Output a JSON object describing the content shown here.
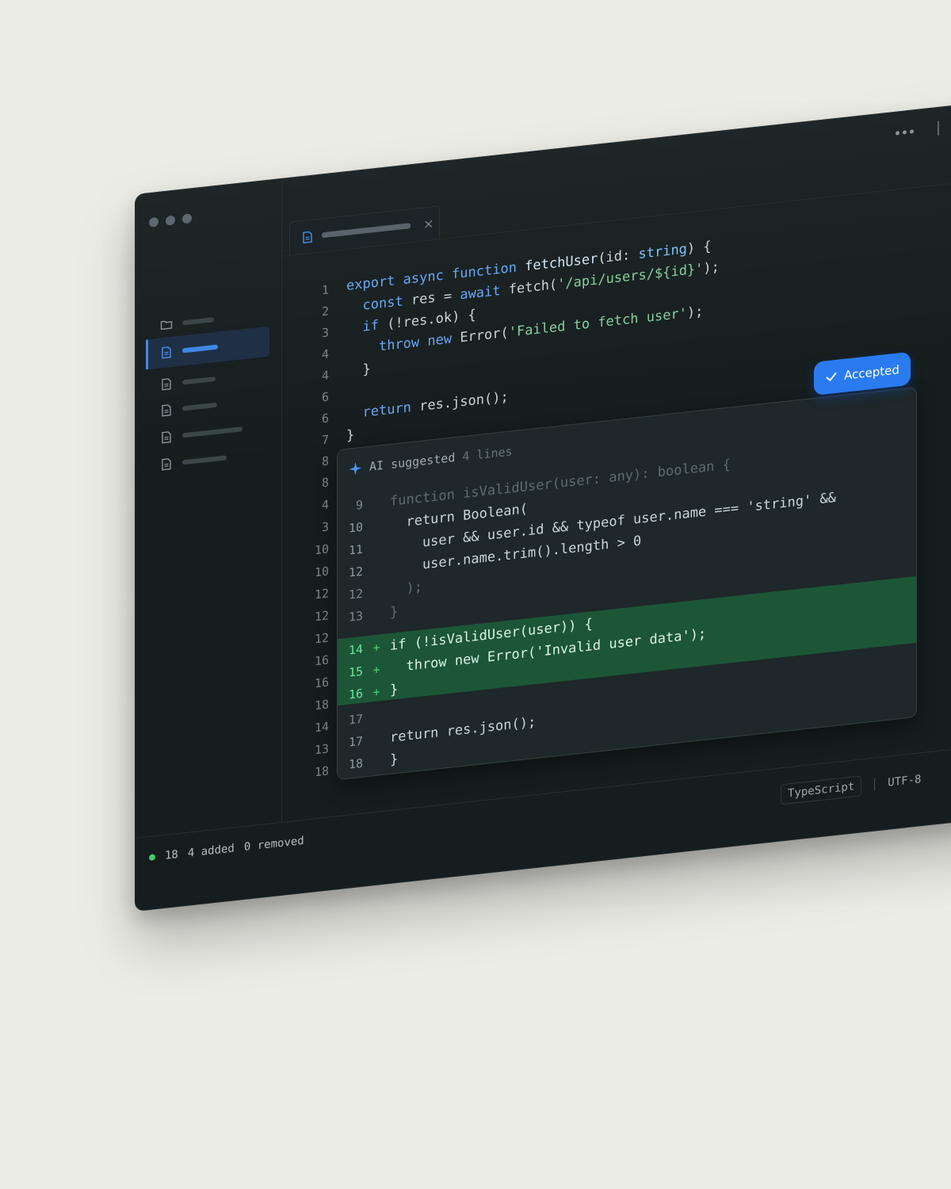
{
  "editor": {
    "code_lines": [
      {
        "num": "1",
        "html": "<span class=\"kw\">export async function</span> <span class=\"fn\">fetchUser</span>(id: <span class=\"ty\">string</span>) {"
      },
      {
        "num": "2",
        "html": "  <span class=\"kw\">const</span> res = <span class=\"kw\">await</span> fetch(<span class=\"str\">'/api/users/${id}'</span>);"
      },
      {
        "num": "3",
        "html": "  <span class=\"kw\">if</span> (!res.ok) {"
      },
      {
        "num": "4",
        "html": "    <span class=\"kw\">throw new</span> Error(<span class=\"str\">'Failed to fetch user'</span>);"
      },
      {
        "num": "4",
        "html": "  }"
      },
      {
        "num": "6",
        "html": ""
      },
      {
        "num": "6",
        "html": "  <span class=\"kw\">return</span> res.json();"
      },
      {
        "num": "7",
        "html": "}"
      },
      {
        "num": "8",
        "html": ""
      }
    ],
    "panel_gutter": [
      "8",
      "4",
      "3",
      "10",
      "10",
      "12",
      "12",
      "12",
      "16",
      "16",
      "18",
      "14",
      "13",
      "18"
    ]
  },
  "ai_panel": {
    "title": "AI suggested",
    "count_label": "4 lines",
    "lines": [
      {
        "num": "9",
        "plus": "",
        "text": "function isValidUser(user: any): boolean {",
        "dim": true
      },
      {
        "num": "10",
        "plus": "",
        "text": "  return Boolean(",
        "dim": false
      },
      {
        "num": "11",
        "plus": "",
        "text": "    user && user.id && typeof user.name === 'string' &&",
        "dim": false
      },
      {
        "num": "12",
        "plus": "",
        "text": "    user.name.trim().length > 0",
        "dim": false
      },
      {
        "num": "12",
        "plus": "",
        "text": "  );",
        "dim": true
      },
      {
        "num": "13",
        "plus": "",
        "text": "}",
        "dim": true
      },
      {
        "num": "14",
        "plus": "+",
        "text": "if (!isValidUser(user)) {",
        "dim": false,
        "added": true
      },
      {
        "num": "15",
        "plus": "+",
        "text": "  throw new Error('Invalid user data');",
        "dim": false,
        "added": true
      },
      {
        "num": "16",
        "plus": "+",
        "text": "}",
        "dim": false,
        "added": true
      },
      {
        "num": "17",
        "plus": "",
        "text": "",
        "dim": true
      },
      {
        "num": "17",
        "plus": "",
        "text": "return res.json();",
        "dim": false
      },
      {
        "num": "18",
        "plus": "",
        "text": "}",
        "dim": false
      }
    ]
  },
  "badge": {
    "label": "Accepted"
  },
  "status": {
    "line_count": "18",
    "added": "4 added",
    "removed": "0 removed",
    "language": "TypeScript",
    "encoding": "UTF-8"
  },
  "colors": {
    "accent": "#2a7bf0",
    "added_bg": "#1c5637",
    "bg": "#151d1e"
  }
}
